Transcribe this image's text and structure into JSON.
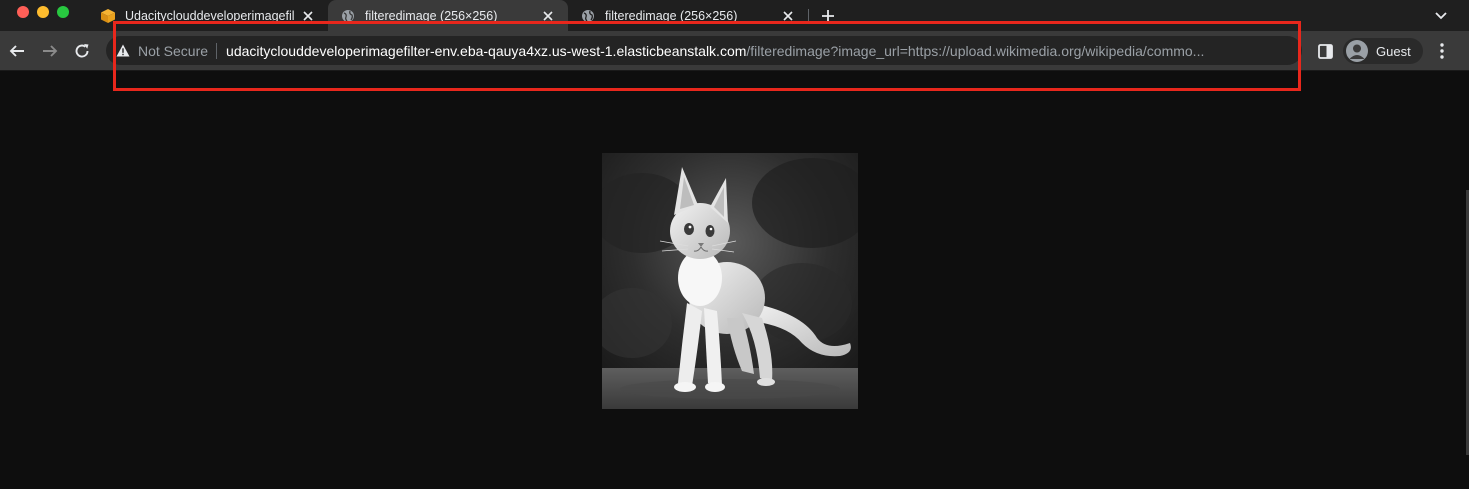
{
  "window": {
    "controls": [
      "close",
      "minimize",
      "zoom"
    ]
  },
  "tabs": [
    {
      "title": "Udacityclouddeveloperimagefil",
      "icon": "package-icon",
      "active": false
    },
    {
      "title": "filteredimage (256×256)",
      "icon": "globe-icon",
      "active": true
    },
    {
      "title": "filteredimage (256×256)",
      "icon": "globe-icon",
      "active": false
    }
  ],
  "new_tab": "+",
  "toolbar": {
    "security_label": "Not Secure",
    "url_host": "udacityclouddeveloperimagefilter-env.eba-qauya4xz.us-west-1.elasticbeanstalk.com",
    "url_path": "/filteredimage?image_url=https://upload.wikimedia.org/wikipedia/commo...",
    "profile_label": "Guest"
  },
  "annotation": {
    "color": "#e8271c",
    "target": "address-bar"
  },
  "content": {
    "image_subject": "grayscale kitten photo",
    "image_width": 256,
    "image_height": 256
  },
  "colors": {
    "tab_strip": "#1f1f1f",
    "toolbar": "#3a3a3a",
    "omnibox": "#242424",
    "page_background": "#0e0e0e"
  }
}
